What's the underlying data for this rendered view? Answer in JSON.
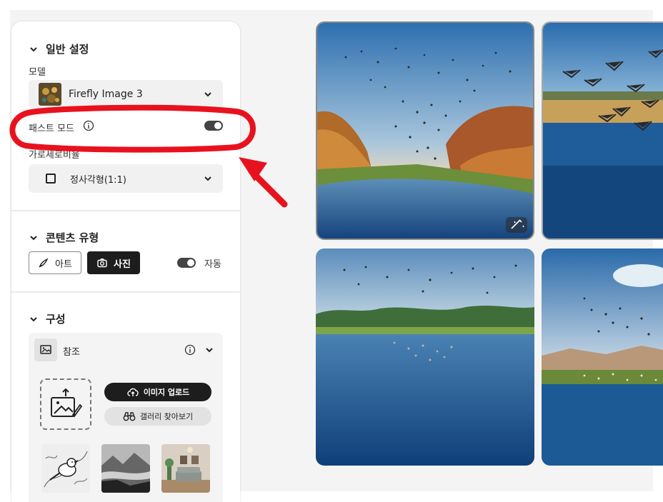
{
  "general": {
    "title": "일반 설정",
    "model_label": "모델",
    "model_value": "Firefly Image 3",
    "fast_mode_label": "패스트 모드",
    "fast_mode_on": true,
    "aspect_label": "가로세로비율",
    "aspect_value": "정사각형(1:1)"
  },
  "content_type": {
    "title": "콘텐츠 유형",
    "art_label": "아트",
    "photo_label": "사진",
    "auto_label": "자동",
    "auto_on": true
  },
  "composition": {
    "title": "구성",
    "reference_label": "참조",
    "upload_label": "이미지 업로드",
    "gallery_label": "갤러리 찾아보기"
  },
  "colors": {
    "annotation_red": "#e8121e",
    "dark_button": "#1d1d1d"
  },
  "icons": {
    "info": "info-icon",
    "chevron": "chevron-down-icon",
    "magic": "magic-wand-icon"
  }
}
